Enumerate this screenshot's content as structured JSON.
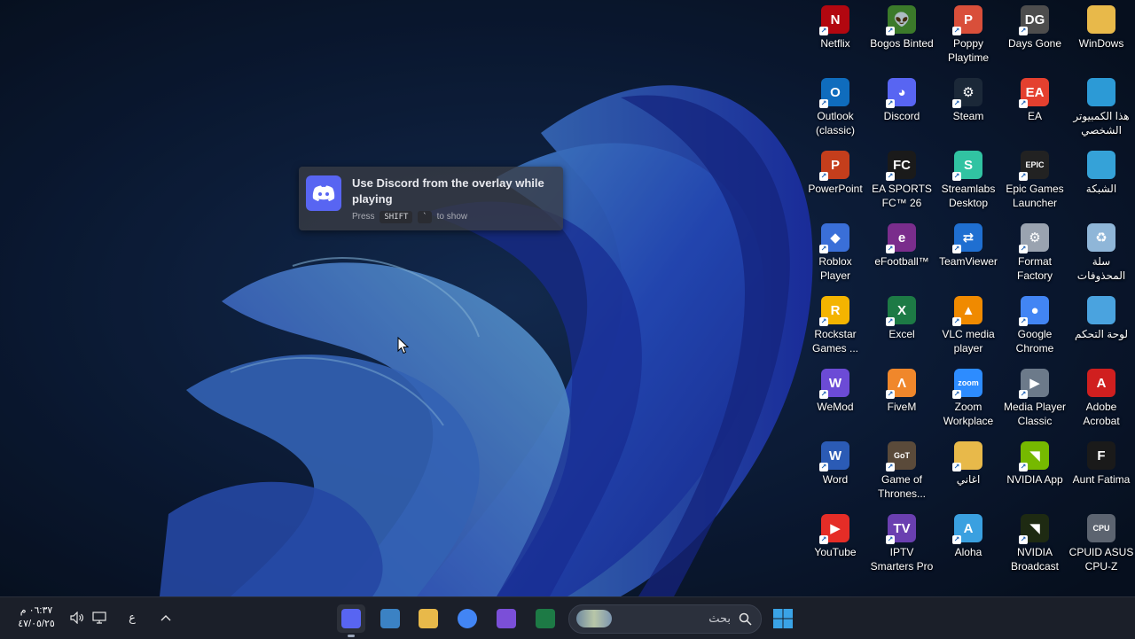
{
  "desktop": {
    "icons": [
      {
        "label": "Netflix",
        "icon": "netflix-icon",
        "color": "#b20710",
        "glyph": "N"
      },
      {
        "label": "Bogos Binted",
        "icon": "alien-icon",
        "color": "#3b7a2a",
        "glyph": "👽"
      },
      {
        "label": "Poppy Playtime",
        "icon": "poppy-playtime-icon",
        "color": "#d94f3a",
        "glyph": "P"
      },
      {
        "label": "Days Gone",
        "icon": "days-gone-icon",
        "color": "#4d4d4d",
        "glyph": "DG"
      },
      {
        "label": "WinDows",
        "icon": "folder-icon",
        "color": "#e8b94a",
        "glyph": ""
      },
      {
        "label": "Outlook (classic)",
        "icon": "outlook-icon",
        "color": "#0f6cbd",
        "glyph": "O"
      },
      {
        "label": "Discord",
        "icon": "discord-icon",
        "color": "#5865f2",
        "glyph": "◕"
      },
      {
        "label": "Steam",
        "icon": "steam-icon",
        "color": "#1b2838",
        "glyph": "⚙"
      },
      {
        "label": "EA",
        "icon": "ea-icon",
        "color": "#e4402f",
        "glyph": "EA"
      },
      {
        "label": "هذا الكمبيوتر الشخصي",
        "icon": "this-pc-icon",
        "color": "#2c9ad6",
        "glyph": ""
      },
      {
        "label": "PowerPoint",
        "icon": "powerpoint-icon",
        "color": "#c43e1c",
        "glyph": "P"
      },
      {
        "label": "EA SPORTS FC™ 26",
        "icon": "ea-sports-fc-icon",
        "color": "#1a1a1a",
        "glyph": "FC"
      },
      {
        "label": "Streamlabs Desktop",
        "icon": "streamlabs-icon",
        "color": "#31c3a2",
        "glyph": "S"
      },
      {
        "label": "Epic Games Launcher",
        "icon": "epic-games-icon",
        "color": "#222222",
        "glyph": "EPIC"
      },
      {
        "label": "الشبكة",
        "icon": "network-icon",
        "color": "#35a2d8",
        "glyph": ""
      },
      {
        "label": "Roblox Player",
        "icon": "roblox-icon",
        "color": "#3a6fd8",
        "glyph": "◆"
      },
      {
        "label": "eFootball™",
        "icon": "efootball-icon",
        "color": "#7a2d8c",
        "glyph": "e"
      },
      {
        "label": "TeamViewer",
        "icon": "teamviewer-icon",
        "color": "#1f6fd1",
        "glyph": "⇄"
      },
      {
        "label": "Format Factory",
        "icon": "format-factory-icon",
        "color": "#9aa3b0",
        "glyph": "⚙"
      },
      {
        "label": "سلة المحذوفات",
        "icon": "recycle-bin-icon",
        "color": "#8fb6d8",
        "glyph": "♻"
      },
      {
        "label": "Rockstar Games ...",
        "icon": "rockstar-icon",
        "color": "#f4b400",
        "glyph": "R"
      },
      {
        "label": "Excel",
        "icon": "excel-icon",
        "color": "#1d7a45",
        "glyph": "X"
      },
      {
        "label": "VLC media player",
        "icon": "vlc-icon",
        "color": "#f08a00",
        "glyph": "▲"
      },
      {
        "label": "Google Chrome",
        "icon": "chrome-icon",
        "color": "#4285f4",
        "glyph": "●"
      },
      {
        "label": "لوحة التحكم",
        "icon": "control-panel-icon",
        "color": "#4aa3df",
        "glyph": ""
      },
      {
        "label": "WeMod",
        "icon": "wemod-icon",
        "color": "#6c4bd6",
        "glyph": "W"
      },
      {
        "label": "FiveM",
        "icon": "fivem-icon",
        "color": "#f0872b",
        "glyph": "Λ"
      },
      {
        "label": "Zoom Workplace",
        "icon": "zoom-icon",
        "color": "#2d8cff",
        "glyph": "zoom"
      },
      {
        "label": "Media Player Classic",
        "icon": "media-player-classic-icon",
        "color": "#6c7a8a",
        "glyph": "▶"
      },
      {
        "label": "Adobe Acrobat",
        "icon": "acrobat-icon",
        "color": "#d01f1f",
        "glyph": "A"
      },
      {
        "label": "Word",
        "icon": "word-icon",
        "color": "#2b5bb5",
        "glyph": "W"
      },
      {
        "label": "Game of Thrones...",
        "icon": "game-of-thrones-icon",
        "color": "#5a4a3a",
        "glyph": "GoT"
      },
      {
        "label": "اغاني",
        "icon": "folder-icon",
        "color": "#e8b94a",
        "glyph": ""
      },
      {
        "label": "NVIDIA App",
        "icon": "nvidia-icon",
        "color": "#76b900",
        "glyph": "◥"
      },
      {
        "label": "Aunt Fatima",
        "icon": "aunt-fatima-icon",
        "color": "#1a1a1a",
        "glyph": "F"
      },
      {
        "label": "YouTube",
        "icon": "youtube-icon",
        "color": "#e52d27",
        "glyph": "▶"
      },
      {
        "label": "IPTV Smarters Pro",
        "icon": "iptv-icon",
        "color": "#6a3fb0",
        "glyph": "TV"
      },
      {
        "label": "Aloha",
        "icon": "aloha-icon",
        "color": "#3aa0e0",
        "glyph": "A"
      },
      {
        "label": "NVIDIA Broadcast",
        "icon": "nvidia-broadcast-icon",
        "color": "#1e2a12",
        "glyph": "◥"
      },
      {
        "label": "CPUID ASUS CPU-Z",
        "icon": "cpuz-icon",
        "color": "#5c6470",
        "glyph": "CPU"
      }
    ]
  },
  "overlay": {
    "title": "Use Discord from the overlay while playing",
    "press": "Press",
    "key1": "SHIFT",
    "key2": "`",
    "to_show": "to show"
  },
  "taskbar": {
    "time": "٠٦:٣٧ م",
    "date": "٤٧/٠٥/٢٥",
    "language": "ع",
    "search_placeholder": "بحث",
    "apps": [
      {
        "icon": "discord-app-icon",
        "color": "#5865f2"
      },
      {
        "icon": "microsoft-store-icon",
        "color": "#3b82c4"
      },
      {
        "icon": "file-explorer-icon",
        "color": "#e8b94a"
      },
      {
        "icon": "chrome-icon",
        "color": "#4285f4"
      },
      {
        "icon": "google-play-games-icon",
        "color": "#7b4fd8"
      },
      {
        "icon": "excel-icon",
        "color": "#1d7a45"
      }
    ],
    "start_color": "#3aa3e6"
  }
}
